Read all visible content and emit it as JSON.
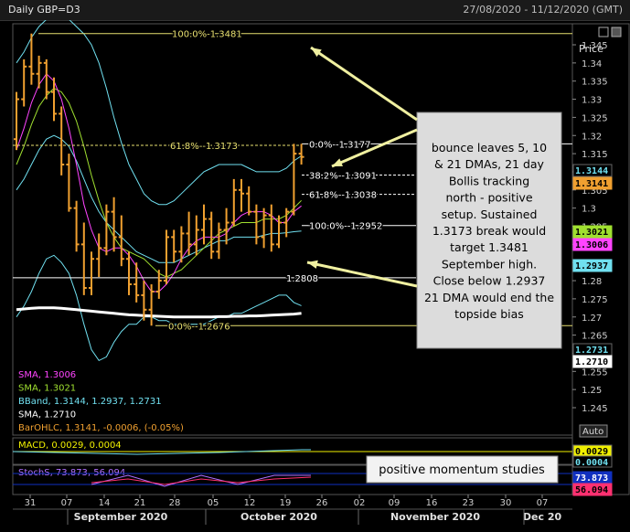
{
  "window": {
    "title": "Daily GBP=D3",
    "date_range": "27/08/2020 - 11/12/2020 (GMT)",
    "price_label": "Price",
    "auto_label": "Auto"
  },
  "colors": {
    "background": "#000000",
    "bars": "#f0a030",
    "sma5": "#ff44ff",
    "sma10": "#a0e030",
    "bband": "#70e0f0",
    "sma200": "#ffffff",
    "fib": "#e8e070",
    "callout_bg": "#dcdcdc",
    "arrow": "#f0f0a0"
  },
  "chart_data": {
    "type": "ohlc",
    "x_ticks": [
      "31",
      "07",
      "14",
      "21",
      "28",
      "05",
      "12",
      "19",
      "26",
      "02",
      "09",
      "16",
      "23",
      "30",
      "07"
    ],
    "month_labels": [
      "September 2020",
      "October 2020",
      "November 2020",
      "Dec 20"
    ],
    "ylim": [
      1.243,
      1.352
    ],
    "y_ticks": [
      "1.345",
      "1.34",
      "1.335",
      "1.33",
      "1.325",
      "1.32",
      "1.315",
      "1.31",
      "1.305",
      "1.3",
      "1.295",
      "1.29",
      "1.285",
      "1.28",
      "1.275",
      "1.27",
      "1.265",
      "1.26",
      "1.255",
      "1.25",
      "1.245"
    ],
    "y_tick_values": [
      1.345,
      1.34,
      1.335,
      1.33,
      1.325,
      1.32,
      1.315,
      1.31,
      1.305,
      1.3,
      1.295,
      1.29,
      1.285,
      1.28,
      1.275,
      1.27,
      1.265,
      1.26,
      1.255,
      1.25,
      1.245
    ],
    "price_tags": [
      {
        "label": "1.3144",
        "value": 1.3144,
        "bg": "#000000",
        "fg": "#70e0f0"
      },
      {
        "label": "1.3141",
        "value": 1.3141,
        "bg": "#f0a030",
        "fg": "#000000"
      },
      {
        "label": "1.3021",
        "value": 1.3021,
        "bg": "#a0e030",
        "fg": "#000000"
      },
      {
        "label": "1.3006",
        "value": 1.3006,
        "bg": "#ff44ff",
        "fg": "#000000"
      },
      {
        "label": "1.2937",
        "value": 1.2937,
        "bg": "#70e0f0",
        "fg": "#000000"
      },
      {
        "label": "1.2731",
        "value": 1.2731,
        "bg": "#000000",
        "fg": "#70e0f0"
      },
      {
        "label": "1.2710",
        "value": 1.271,
        "bg": "#ffffff",
        "fg": "#000000"
      }
    ],
    "ohlc": [
      {
        "o": 1.319,
        "h": 1.332,
        "l": 1.316,
        "c": 1.33
      },
      {
        "o": 1.33,
        "h": 1.341,
        "l": 1.328,
        "c": 1.339
      },
      {
        "o": 1.339,
        "h": 1.3481,
        "l": 1.334,
        "c": 1.337
      },
      {
        "o": 1.337,
        "h": 1.342,
        "l": 1.333,
        "c": 1.34
      },
      {
        "o": 1.34,
        "h": 1.341,
        "l": 1.33,
        "c": 1.332
      },
      {
        "o": 1.332,
        "h": 1.336,
        "l": 1.324,
        "c": 1.326
      },
      {
        "o": 1.326,
        "h": 1.328,
        "l": 1.309,
        "c": 1.312
      },
      {
        "o": 1.312,
        "h": 1.315,
        "l": 1.299,
        "c": 1.3
      },
      {
        "o": 1.3,
        "h": 1.302,
        "l": 1.288,
        "c": 1.29
      },
      {
        "o": 1.29,
        "h": 1.296,
        "l": 1.276,
        "c": 1.278
      },
      {
        "o": 1.278,
        "h": 1.288,
        "l": 1.276,
        "c": 1.286
      },
      {
        "o": 1.286,
        "h": 1.293,
        "l": 1.281,
        "c": 1.289
      },
      {
        "o": 1.289,
        "h": 1.301,
        "l": 1.287,
        "c": 1.299
      },
      {
        "o": 1.299,
        "h": 1.303,
        "l": 1.288,
        "c": 1.292
      },
      {
        "o": 1.292,
        "h": 1.298,
        "l": 1.284,
        "c": 1.286
      },
      {
        "o": 1.286,
        "h": 1.288,
        "l": 1.276,
        "c": 1.279
      },
      {
        "o": 1.279,
        "h": 1.285,
        "l": 1.274,
        "c": 1.276
      },
      {
        "o": 1.276,
        "h": 1.28,
        "l": 1.269,
        "c": 1.272
      },
      {
        "o": 1.272,
        "h": 1.279,
        "l": 1.2676,
        "c": 1.277
      },
      {
        "o": 1.277,
        "h": 1.283,
        "l": 1.275,
        "c": 1.28
      },
      {
        "o": 1.28,
        "h": 1.294,
        "l": 1.279,
        "c": 1.292
      },
      {
        "o": 1.292,
        "h": 1.294,
        "l": 1.285,
        "c": 1.288
      },
      {
        "o": 1.288,
        "h": 1.295,
        "l": 1.285,
        "c": 1.293
      },
      {
        "o": 1.293,
        "h": 1.299,
        "l": 1.287,
        "c": 1.29
      },
      {
        "o": 1.29,
        "h": 1.298,
        "l": 1.287,
        "c": 1.294
      },
      {
        "o": 1.294,
        "h": 1.301,
        "l": 1.29,
        "c": 1.297
      },
      {
        "o": 1.297,
        "h": 1.299,
        "l": 1.286,
        "c": 1.288
      },
      {
        "o": 1.288,
        "h": 1.296,
        "l": 1.286,
        "c": 1.294
      },
      {
        "o": 1.294,
        "h": 1.3,
        "l": 1.29,
        "c": 1.296
      },
      {
        "o": 1.296,
        "h": 1.308,
        "l": 1.295,
        "c": 1.305
      },
      {
        "o": 1.305,
        "h": 1.308,
        "l": 1.299,
        "c": 1.304
      },
      {
        "o": 1.304,
        "h": 1.306,
        "l": 1.298,
        "c": 1.299
      },
      {
        "o": 1.299,
        "h": 1.301,
        "l": 1.29,
        "c": 1.292
      },
      {
        "o": 1.292,
        "h": 1.3,
        "l": 1.289,
        "c": 1.298
      },
      {
        "o": 1.298,
        "h": 1.301,
        "l": 1.288,
        "c": 1.29
      },
      {
        "o": 1.29,
        "h": 1.298,
        "l": 1.289,
        "c": 1.296
      },
      {
        "o": 1.296,
        "h": 1.3,
        "l": 1.292,
        "c": 1.299
      },
      {
        "o": 1.299,
        "h": 1.3177,
        "l": 1.298,
        "c": 1.315
      },
      {
        "o": 1.315,
        "h": 1.3177,
        "l": 1.312,
        "c": 1.3141
      }
    ],
    "sma5": [
      1.316,
      1.322,
      1.329,
      1.334,
      1.337,
      1.335,
      1.33,
      1.322,
      1.312,
      1.301,
      1.294,
      1.289,
      1.288,
      1.289,
      1.289,
      1.287,
      1.284,
      1.28,
      1.277,
      1.277,
      1.279,
      1.282,
      1.286,
      1.289,
      1.291,
      1.292,
      1.292,
      1.292,
      1.293,
      1.296,
      1.298,
      1.299,
      1.299,
      1.299,
      1.298,
      1.296,
      1.296,
      1.299,
      1.3006
    ],
    "sma10": [
      1.312,
      1.317,
      1.323,
      1.328,
      1.331,
      1.333,
      1.332,
      1.329,
      1.324,
      1.317,
      1.309,
      1.302,
      1.296,
      1.292,
      1.289,
      1.288,
      1.287,
      1.286,
      1.284,
      1.282,
      1.281,
      1.282,
      1.283,
      1.285,
      1.287,
      1.289,
      1.291,
      1.293,
      1.294,
      1.295,
      1.296,
      1.296,
      1.296,
      1.297,
      1.297,
      1.297,
      1.298,
      1.3,
      1.3021
    ],
    "bb_upper": [
      1.34,
      1.343,
      1.347,
      1.35,
      1.352,
      1.353,
      1.353,
      1.352,
      1.35,
      1.348,
      1.345,
      1.34,
      1.333,
      1.325,
      1.318,
      1.312,
      1.308,
      1.304,
      1.302,
      1.301,
      1.301,
      1.302,
      1.304,
      1.306,
      1.308,
      1.31,
      1.311,
      1.312,
      1.312,
      1.312,
      1.312,
      1.311,
      1.31,
      1.31,
      1.31,
      1.31,
      1.311,
      1.313,
      1.3144
    ],
    "bb_mid": [
      1.305,
      1.308,
      1.312,
      1.316,
      1.319,
      1.32,
      1.319,
      1.317,
      1.313,
      1.308,
      1.303,
      1.299,
      1.296,
      1.294,
      1.292,
      1.29,
      1.288,
      1.287,
      1.286,
      1.285,
      1.285,
      1.285,
      1.286,
      1.287,
      1.288,
      1.289,
      1.29,
      1.291,
      1.291,
      1.292,
      1.292,
      1.292,
      1.292,
      1.2925,
      1.293,
      1.293,
      1.2932,
      1.2935,
      1.2937
    ],
    "bb_lower": [
      1.27,
      1.273,
      1.277,
      1.282,
      1.286,
      1.287,
      1.285,
      1.282,
      1.276,
      1.268,
      1.261,
      1.258,
      1.259,
      1.263,
      1.266,
      1.268,
      1.268,
      1.27,
      1.27,
      1.269,
      1.269,
      1.268,
      1.268,
      1.268,
      1.268,
      1.268,
      1.269,
      1.27,
      1.27,
      1.271,
      1.271,
      1.272,
      1.273,
      1.274,
      1.275,
      1.276,
      1.276,
      1.274,
      1.2731
    ],
    "sma200": [
      1.272,
      1.2722,
      1.2724,
      1.2725,
      1.2725,
      1.2725,
      1.2724,
      1.2722,
      1.272,
      1.2718,
      1.2716,
      1.2714,
      1.2712,
      1.271,
      1.2708,
      1.2706,
      1.2705,
      1.2704,
      1.2703,
      1.2702,
      1.2701,
      1.27,
      1.27,
      1.27,
      1.27,
      1.27,
      1.27,
      1.2701,
      1.2701,
      1.2702,
      1.2702,
      1.2703,
      1.2703,
      1.2704,
      1.2705,
      1.2706,
      1.2707,
      1.2708,
      1.271
    ],
    "fib_lines": [
      {
        "label": "100.0%-1.3481",
        "value": 1.3481,
        "style": "solid"
      },
      {
        "label": "61.8%--1.3173",
        "value": 1.3173,
        "style": "dashed"
      },
      {
        "label": "0.0%--1.3177",
        "value": 1.3177,
        "style": "solid"
      },
      {
        "label": "38.2%--1.3091",
        "value": 1.3091,
        "style": "dashed"
      },
      {
        "label": "61.8%--1.3038",
        "value": 1.3038,
        "style": "dashed"
      },
      {
        "label": "100.0%--1.2952",
        "value": 1.2952,
        "style": "solid"
      },
      {
        "label": "1.2808",
        "value": 1.2808,
        "style": "solid"
      },
      {
        "label": "0.0%--1.2676",
        "value": 1.2676,
        "style": "solid"
      }
    ],
    "legend": [
      {
        "text": "SMA, 1.3006",
        "color": "#ff44ff"
      },
      {
        "text": "SMA, 1.3021",
        "color": "#a0e030"
      },
      {
        "text": "BBand, 1.3144, 1.2937, 1.2731",
        "color": "#70e0f0"
      },
      {
        "text": "SMA, 1.2710",
        "color": "#ffffff"
      },
      {
        "text": "BarOHLC, 1.3141, -0.0006, (-0.05%)",
        "color": "#f0a030"
      }
    ],
    "callout": "bounce leaves 5, 10 & 21 DMAs, 21 day Bollis tracking north - positive setup. Sustained 1.3173 break would target 1.3481 September high. Close below 1.2937 21 DMA would end the topside bias",
    "macd": {
      "label": "MACD, 0.0029, 0.0004",
      "values": [
        0.0029,
        0.0004
      ],
      "tags": [
        {
          "label": "0.0029",
          "bg": "#f0f000",
          "fg": "#000000"
        },
        {
          "label": "0.0004",
          "bg": "#000000",
          "fg": "#70e0f0"
        }
      ]
    },
    "stochs": {
      "label": "StochS, 73.873, 56.094",
      "values": [
        73.873,
        56.094
      ],
      "tags": [
        {
          "label": "73.873",
          "bg": "#1030c0",
          "fg": "#ffffff"
        },
        {
          "label": "56.094",
          "bg": "#ff3070",
          "fg": "#000000"
        }
      ]
    },
    "momentum_note": "positive momentum studies"
  }
}
